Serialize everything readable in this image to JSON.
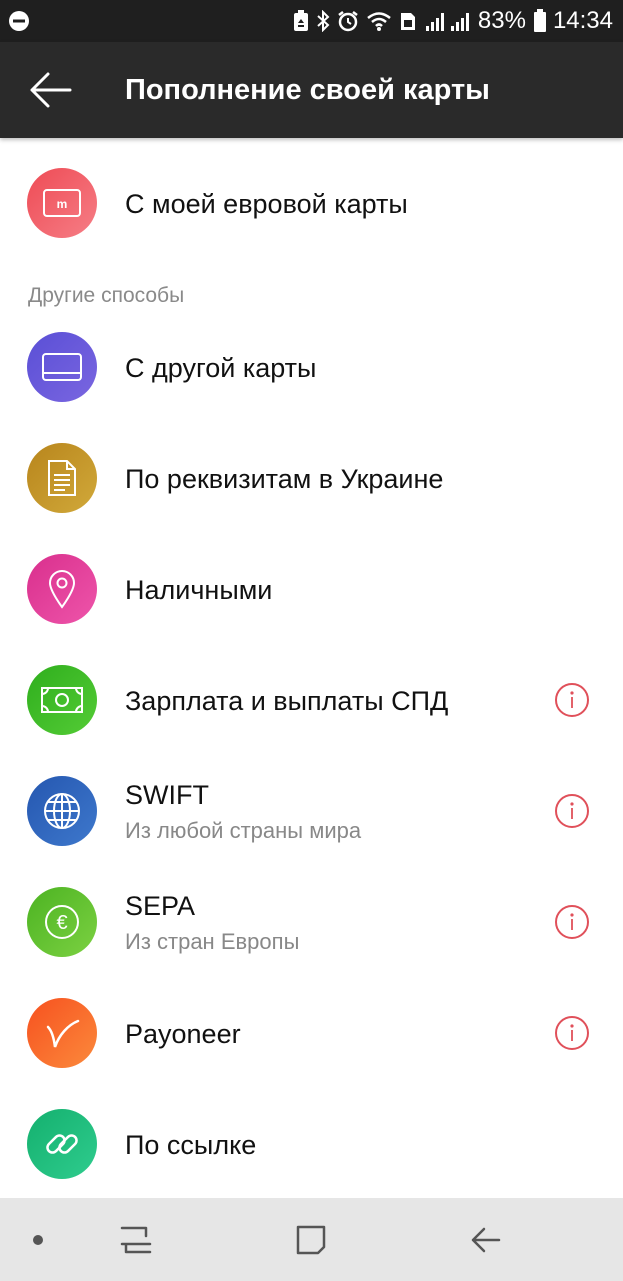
{
  "status_bar": {
    "battery_percent": "83%",
    "time": "14:34",
    "icons": [
      "circle-minus-icon",
      "recycle-battery-icon",
      "bluetooth-icon",
      "alarm-icon",
      "wifi-icon",
      "sim-icon",
      "signal-icon",
      "battery-icon"
    ]
  },
  "header": {
    "back_icon": "arrow-left-icon",
    "title": "Пополнение своей карты"
  },
  "main": {
    "own_card": {
      "label": "С моей евровой карты",
      "icon": "card-m-icon",
      "color": "#ef5a64"
    },
    "section_label": "Другие способы",
    "methods": [
      {
        "label": "С другой карты",
        "subtitle": "",
        "icon": "card-icon",
        "color": "#6559d8",
        "info": false
      },
      {
        "label": "По реквизитам в Украине",
        "subtitle": "",
        "icon": "document-icon",
        "color": "#c39425",
        "info": false
      },
      {
        "label": "Наличными",
        "subtitle": "",
        "icon": "location-pin-icon",
        "color": "#e03d96",
        "info": false
      },
      {
        "label": "Зарплата и выплаты СПД",
        "subtitle": "",
        "icon": "banknote-icon",
        "color": "#3dbb28",
        "info": true
      },
      {
        "label": "SWIFT",
        "subtitle": "Из любой страны мира",
        "icon": "globe-icon",
        "color": "#2f63ba",
        "info": true
      },
      {
        "label": "SEPA",
        "subtitle": "Из стран Европы",
        "icon": "euro-icon",
        "color": "#5bc02c",
        "info": true
      },
      {
        "label": "Payoneer",
        "subtitle": "",
        "icon": "payoneer-icon",
        "color": "#f9642a",
        "info": true
      },
      {
        "label": "По ссылке",
        "subtitle": "",
        "icon": "link-icon",
        "color": "#1fbb7a",
        "info": false
      }
    ],
    "info_icon": "info-icon",
    "accent_color": "#e0505a"
  },
  "nav_bar": {
    "items": [
      "dot-icon",
      "recent-apps-icon",
      "home-icon",
      "back-icon"
    ]
  }
}
